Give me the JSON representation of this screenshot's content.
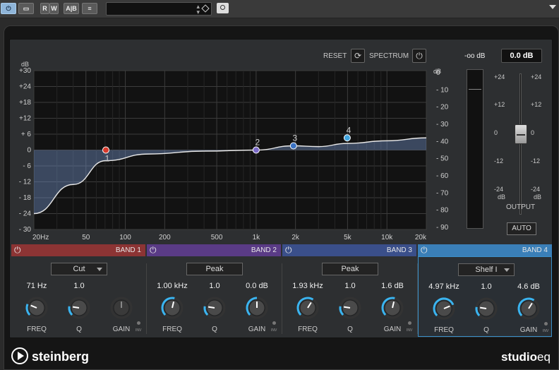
{
  "toolbar": {
    "buttons": [
      {
        "name": "power-button",
        "label": "⏻",
        "active": true
      },
      {
        "name": "bypass-button",
        "label": "▭",
        "active": false
      },
      {
        "name": "read-button",
        "label": "R",
        "active": false
      },
      {
        "name": "write-button",
        "label": "W",
        "active": false
      },
      {
        "name": "compare-button",
        "label": "A|B",
        "active": false
      },
      {
        "name": "menu-button",
        "label": "≡",
        "active": false
      }
    ],
    "preset_value": ""
  },
  "controls": {
    "reset_label": "RESET",
    "spectrum_label": "SPECTRUM"
  },
  "graph": {
    "db_left_title": "dB",
    "db_right_title": "dB",
    "db_left_ticks": [
      "+30",
      "+24",
      "+18",
      "+12",
      "+ 6",
      "0",
      "- 6",
      "- 12",
      "- 18",
      "- 24",
      "- 30"
    ],
    "db_right_ticks": [
      "0",
      "- 10",
      "- 20",
      "- 30",
      "- 40",
      "- 50",
      "- 60",
      "- 70",
      "- 80",
      "- 90"
    ],
    "freq_ticks": [
      {
        "label": "20Hz",
        "hz": 20
      },
      {
        "label": "50",
        "hz": 50
      },
      {
        "label": "100",
        "hz": 100
      },
      {
        "label": "200",
        "hz": 200
      },
      {
        "label": "500",
        "hz": 500
      },
      {
        "label": "1k",
        "hz": 1000
      },
      {
        "label": "2k",
        "hz": 2000
      },
      {
        "label": "5k",
        "hz": 5000
      },
      {
        "label": "10k",
        "hz": 10000
      },
      {
        "label": "20k",
        "hz": 20000
      }
    ],
    "nodes": [
      {
        "label": "1",
        "hz": 71,
        "db": 0,
        "color": "#d83a2c"
      },
      {
        "label": "2",
        "hz": 1000,
        "db": 0,
        "color": "#7c6bc9"
      },
      {
        "label": "3",
        "hz": 1930,
        "db": 1.6,
        "color": "#3a72c4"
      },
      {
        "label": "4",
        "hz": 4970,
        "db": 4.6,
        "color": "#42a6e0"
      }
    ],
    "curve": [
      [
        20,
        -24
      ],
      [
        40,
        -13
      ],
      [
        71,
        -4
      ],
      [
        150,
        -1.5
      ],
      [
        400,
        -0.4
      ],
      [
        1000,
        0
      ],
      [
        1930,
        1.6
      ],
      [
        3000,
        1.3
      ],
      [
        4970,
        2.5
      ],
      [
        10000,
        3.5
      ],
      [
        20000,
        4.6
      ]
    ]
  },
  "output": {
    "peak_label": "-oo dB",
    "value_label": "0.0 dB",
    "scale_left": [
      "+24",
      "+12",
      "0",
      "-12",
      "-24"
    ],
    "scale_right": [
      "+24",
      "+12",
      "0",
      "-12",
      "-24"
    ],
    "unit_left": "dB",
    "unit_right": "dB",
    "section_label": "OUTPUT",
    "auto_label": "AUTO"
  },
  "bands": [
    {
      "title": "BAND 1",
      "type": "Cut",
      "freq": "71 Hz",
      "q": "1.0",
      "gain": "",
      "freq_label": "FREQ",
      "q_label": "Q",
      "gain_label": "GAIN",
      "inv_label": "INV",
      "color": "#8c3434",
      "freq_level": 0.25,
      "q_level": 0.2,
      "gain_level": 0.5,
      "gain_enabled": false,
      "selected": false
    },
    {
      "title": "BAND 2",
      "type": "Peak",
      "freq": "1.00 kHz",
      "q": "1.0",
      "gain": "0.0 dB",
      "freq_label": "FREQ",
      "q_label": "Q",
      "gain_label": "GAIN",
      "inv_label": "INV",
      "color": "#5a3b86",
      "freq_level": 0.55,
      "q_level": 0.2,
      "gain_level": 0.5,
      "gain_enabled": true,
      "selected": false
    },
    {
      "title": "BAND 3",
      "type": "Peak",
      "freq": "1.93 kHz",
      "q": "1.0",
      "gain": "1.6 dB",
      "freq_label": "FREQ",
      "q_label": "Q",
      "gain_label": "GAIN",
      "inv_label": "INV",
      "color": "#3a4f8a",
      "freq_level": 0.62,
      "q_level": 0.2,
      "gain_level": 0.55,
      "gain_enabled": true,
      "selected": false
    },
    {
      "title": "BAND 4",
      "type": "Shelf I",
      "freq": "4.97 kHz",
      "q": "1.0",
      "gain": "4.6 dB",
      "freq_label": "FREQ",
      "q_label": "Q",
      "gain_label": "GAIN",
      "inv_label": "INV",
      "color": "#3a7fb8",
      "freq_level": 0.75,
      "q_level": 0.2,
      "gain_level": 0.62,
      "gain_enabled": true,
      "selected": true
    }
  ],
  "footer": {
    "brand": "steinberg",
    "product_a": "studio",
    "product_b": "eq"
  },
  "icons": {
    "power": "⏻",
    "reset": "⟳"
  }
}
